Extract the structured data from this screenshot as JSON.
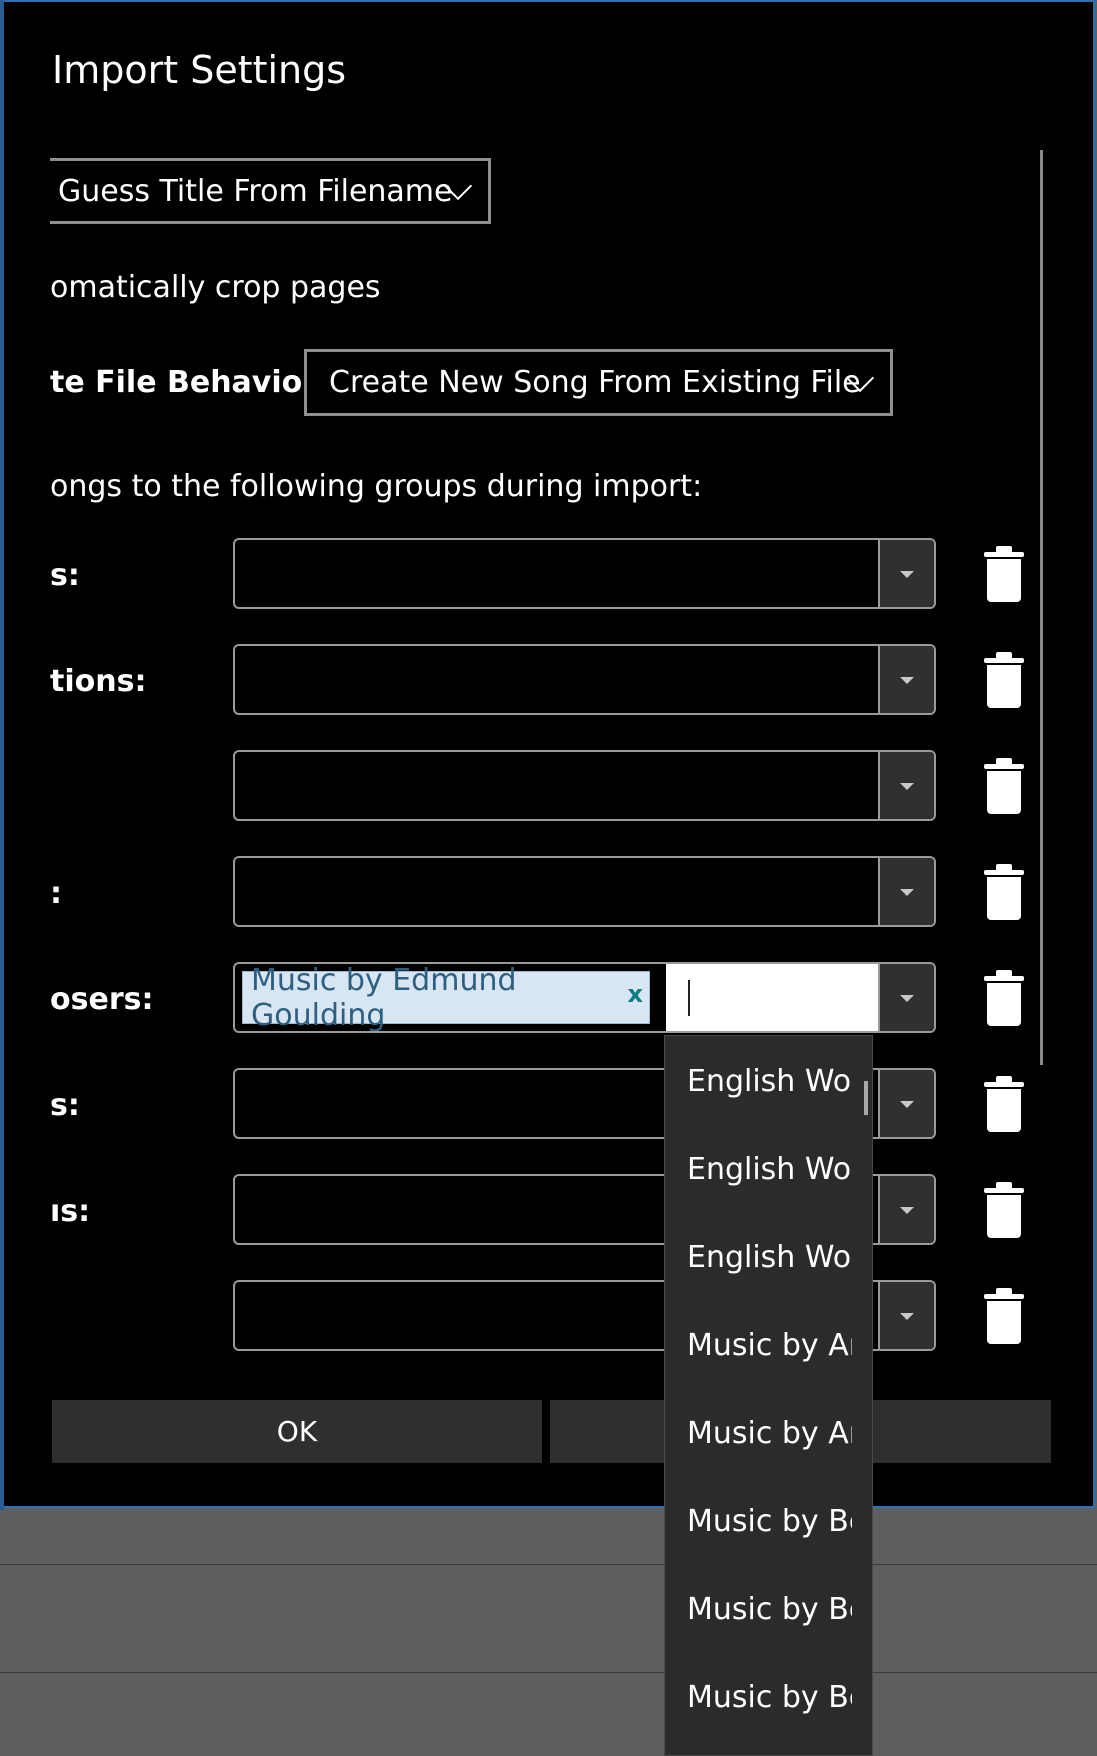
{
  "dialog": {
    "title": "Import Settings",
    "title_dropdown": "Guess Title From Filename",
    "crop_option": "omatically crop pages",
    "behavior_label": "te File Behavior:",
    "behavior_value": "Create New Song From Existing File",
    "groups_intro": "ongs to the following groups during import:"
  },
  "groups": [
    {
      "label": "s:"
    },
    {
      "label": "tions:"
    },
    {
      "label": ""
    },
    {
      "label": ":"
    },
    {
      "label": "osers:",
      "chip": "Music by Edmund Goulding",
      "chip_remove": "x"
    },
    {
      "label": "s:"
    },
    {
      "label": "ıs:"
    },
    {
      "label": ""
    }
  ],
  "dropdown_items": [
    "English Word",
    "English Word",
    "English Word",
    "Music by An",
    "Music by Art",
    "Music by Bea",
    "Music by Ber",
    "Music by Ber"
  ],
  "buttons": {
    "ok": "OK",
    "cancel": ""
  },
  "colors": {
    "accent_border": "#2f6fb3",
    "chip_bg": "#d7e6f2",
    "chip_text": "#2f5f80",
    "chip_remove": "#0e7c86"
  }
}
